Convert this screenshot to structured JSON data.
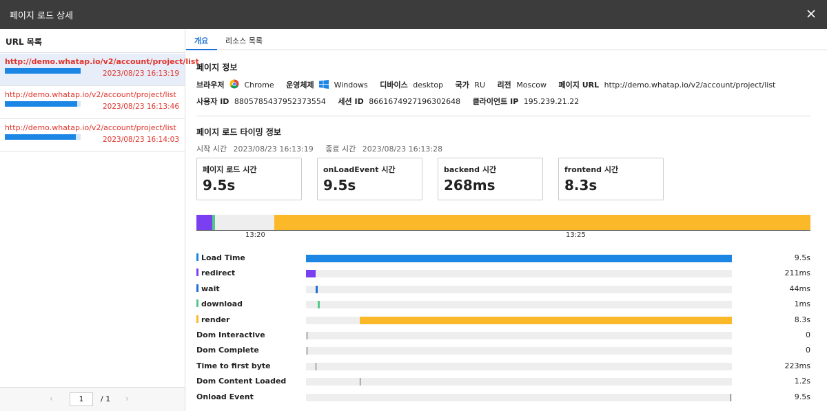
{
  "dialog": {
    "title": "페이지 로드 상세",
    "close_icon": "close-icon"
  },
  "url_list": {
    "header": "URL 목록",
    "items": [
      {
        "url": "http://demo.whatap.io/v2/account/project/list",
        "time": "2023/08/23 16:13:19",
        "load_fraction": 1.0,
        "selected": true
      },
      {
        "url": "http://demo.whatap.io/v2/account/project/list",
        "time": "2023/08/23 16:13:46",
        "load_fraction": 0.95,
        "selected": false
      },
      {
        "url": "http://demo.whatap.io/v2/account/project/list",
        "time": "2023/08/23 16:14:03",
        "load_fraction": 0.94,
        "selected": false
      }
    ],
    "pager": {
      "prev": "‹",
      "next": "›",
      "page": "1",
      "total": "/ 1"
    }
  },
  "tabs": [
    {
      "label": "개요",
      "active": true
    },
    {
      "label": "리소스 목록",
      "active": false
    }
  ],
  "page_info": {
    "title": "페이지 정보",
    "browser_label": "브라우저",
    "browser": "Chrome",
    "os_label": "운영체제",
    "os": "Windows",
    "device_label": "디바이스",
    "device": "desktop",
    "country_label": "국가",
    "country": "RU",
    "region_label": "리전",
    "region": "Moscow",
    "page_url_label": "페이지 URL",
    "page_url": "http://demo.whatap.io/v2/account/project/list",
    "user_id_label": "사용자 ID",
    "user_id": "8805785437952373554",
    "session_id_label": "세션 ID",
    "session_id": "8661674927196302648",
    "client_ip_label": "클라이언트 IP",
    "client_ip": "195.239.21.22"
  },
  "timing": {
    "title": "페이지 로드 타이밍 정보",
    "start_label": "시작 시간",
    "start": "2023/08/23 16:13:19",
    "end_label": "종료 시간",
    "end": "2023/08/23 16:13:28",
    "cards": [
      {
        "label": "페이지 로드 시간",
        "value": "9.5s"
      },
      {
        "label": "onLoadEvent 시간",
        "value": "9.5s"
      },
      {
        "label": "backend 시간",
        "value": "268ms"
      },
      {
        "label": "frontend 시간",
        "value": "8.3s"
      }
    ],
    "timeline": {
      "ticks": [
        "13:20",
        "13:25"
      ],
      "colors": {
        "redirect": "#7b3ff2",
        "download": "#52c98a",
        "wait": "#1c6fd8",
        "render": "#fbb829"
      }
    },
    "metrics": [
      {
        "label": "Load Time",
        "value": "9.5s",
        "color": "#1c86e5",
        "type": "bar",
        "start": 0.0,
        "span": 1.0
      },
      {
        "label": "redirect",
        "value": "211ms",
        "color": "#7b3ff2",
        "type": "bar",
        "start": 0.0,
        "span": 0.022
      },
      {
        "label": "wait",
        "value": "44ms",
        "color": "#1c6fd8",
        "type": "bar",
        "start": 0.023,
        "span": 0.005
      },
      {
        "label": "download",
        "value": "1ms",
        "color": "#52c98a",
        "type": "bar",
        "start": 0.028,
        "span": 0.005
      },
      {
        "label": "render",
        "value": "8.3s",
        "color": "#fbb829",
        "type": "bar",
        "start": 0.127,
        "span": 0.873
      },
      {
        "label": "Dom Interactive",
        "value": "0",
        "color": "",
        "type": "line",
        "start": 0.001
      },
      {
        "label": "Dom Complete",
        "value": "0",
        "color": "",
        "type": "line",
        "start": 0.001
      },
      {
        "label": "Time to first byte",
        "value": "223ms",
        "color": "",
        "type": "line",
        "start": 0.023
      },
      {
        "label": "Dom Content Loaded",
        "value": "1.2s",
        "color": "",
        "type": "line",
        "start": 0.127
      },
      {
        "label": "Onload Event",
        "value": "9.5s",
        "color": "",
        "type": "line",
        "start": 0.997
      }
    ]
  }
}
